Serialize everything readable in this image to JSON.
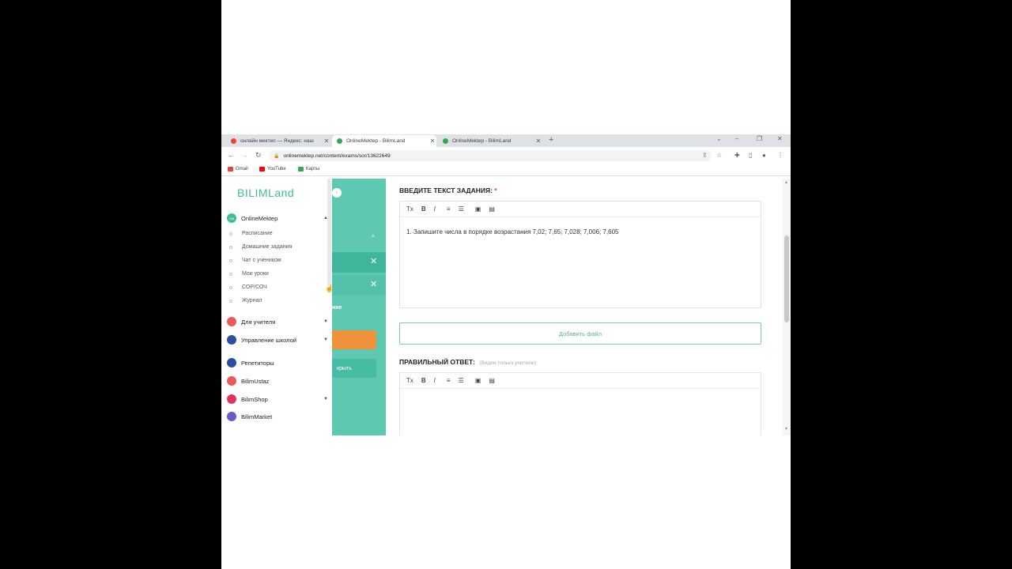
{
  "tabs": [
    {
      "title": "онлайн мектеп — Яндекс: наш",
      "favicon_color": "#e8453c",
      "active": false
    },
    {
      "title": "OnlineMektep - BilimLand",
      "favicon_color": "#34a853",
      "active": true
    },
    {
      "title": "OnlineMektep - BilimLand",
      "favicon_color": "#34a853",
      "active": false
    }
  ],
  "address": {
    "url": "onlinemektep.net/content/exams/sor/13622649"
  },
  "bookmarks": [
    {
      "label": "Gmail",
      "color": "#ea4335"
    },
    {
      "label": "YouTube",
      "color": "#ff0000"
    },
    {
      "label": "Карты",
      "color": "#34a853"
    }
  ],
  "sidebar": {
    "logo": "BILIMLand",
    "groups_top": {
      "label": "OnlineMektep",
      "color": "#3fbf8f"
    },
    "subitems": [
      "Расписание",
      "Домашние задания",
      "Чат с учеником",
      "Мои уроки",
      "СОР/СОЧ",
      "Журнал"
    ],
    "groups": [
      {
        "label": "Для учителя",
        "color": "#e85b5b",
        "chevron": true
      },
      {
        "label": "Управление школой",
        "color": "#2b4fa0",
        "chevron": true
      },
      {
        "label": "Репетиторы",
        "color": "#2b4fa0",
        "chevron": false
      },
      {
        "label": "BilimUstaz",
        "color": "#e85b5b",
        "chevron": false
      },
      {
        "label": "BilimShop",
        "color": "#e0335c",
        "chevron": true
      },
      {
        "label": "BilimMarket",
        "color": "#6a5acd",
        "chevron": false
      }
    ]
  },
  "teal_panel": {
    "label_fragment": "ние",
    "open_button": "крыть"
  },
  "form": {
    "task_label": "ВВЕДИТЕ ТЕКСТ ЗАДАНИЯ:",
    "required_mark": "*",
    "task_text": "1. Запишите числа в порядке возрастания 7,02; 7,65; 7,028; 7,006; 7,605",
    "add_file": "Добавить файл",
    "answer_label": "ПРАВИЛЬНЫЙ ОТВЕТ:",
    "answer_note": "(Виден только учителю)",
    "toolbar": [
      "Tx",
      "B",
      "I",
      "≡",
      "☰",
      "▣",
      "▤"
    ]
  }
}
